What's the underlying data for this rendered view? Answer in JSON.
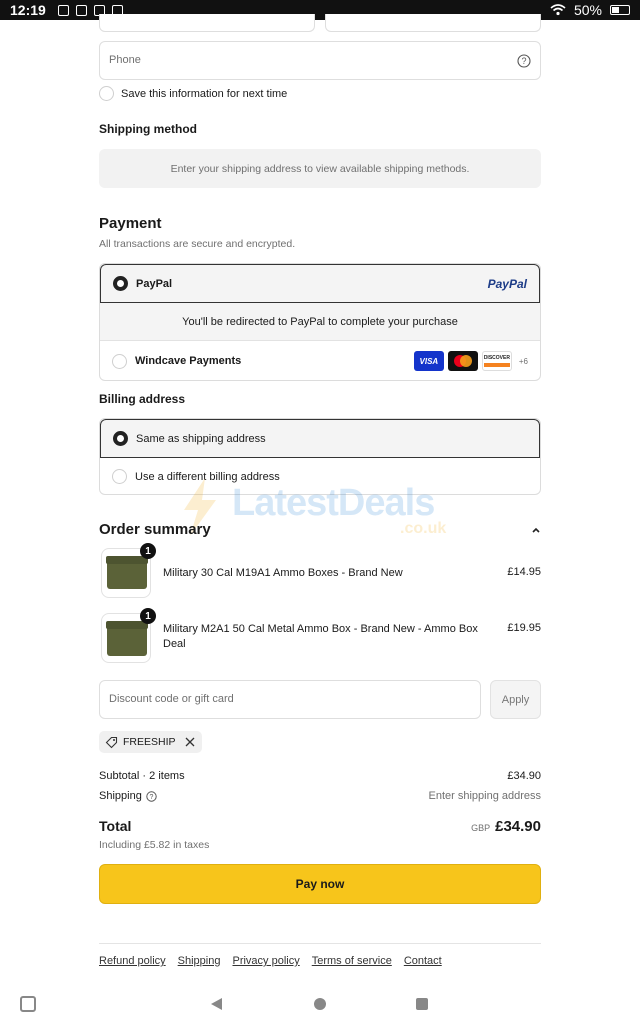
{
  "status_bar": {
    "time": "12:19",
    "battery": "50%"
  },
  "contact": {
    "phone_placeholder": "Phone",
    "save_info_label": "Save this information for next time"
  },
  "shipping_method": {
    "heading": "Shipping method",
    "message": "Enter your shipping address to view available shipping methods."
  },
  "payment": {
    "heading": "Payment",
    "subtitle": "All transactions are secure and encrypted.",
    "options": [
      {
        "label": "PayPal",
        "logo_text": "PayPal",
        "selected": true
      },
      {
        "label": "Windcave Payments",
        "selected": false
      }
    ],
    "redirect_note": "You'll be redirected to PayPal to complete your purchase",
    "card_brands": [
      "VISA",
      "DISCOVER"
    ],
    "more_brands": "+6"
  },
  "billing": {
    "heading": "Billing address",
    "options": [
      {
        "label": "Same as shipping address",
        "selected": true
      },
      {
        "label": "Use a different billing address",
        "selected": false
      }
    ]
  },
  "watermark": {
    "brand": "LatestDeals",
    "domain": ".co.uk"
  },
  "order_summary": {
    "heading": "Order summary",
    "items": [
      {
        "name": "Military 30 Cal M19A1 Ammo Boxes - Brand New",
        "price": "£14.95",
        "quantity": "1"
      },
      {
        "name": "Military M2A1 50 Cal Metal Ammo Box - Brand New - Ammo Box Deal",
        "price": "£19.95",
        "quantity": "1"
      }
    ],
    "discount_placeholder": "Discount code or gift card",
    "apply_label": "Apply",
    "applied_code": "FREESHIP",
    "subtotal_label": "Subtotal · 2 items",
    "subtotal_value": "£34.90",
    "shipping_label": "Shipping",
    "shipping_value": "Enter shipping address",
    "total_label": "Total",
    "currency": "GBP",
    "total_value": "£34.90",
    "tax_note": "Including £5.82 in taxes"
  },
  "pay_button": {
    "label": "Pay now",
    "color": "#f7c51b"
  },
  "footer": {
    "links": [
      "Refund policy",
      "Shipping",
      "Privacy policy",
      "Terms of service",
      "Contact"
    ]
  }
}
